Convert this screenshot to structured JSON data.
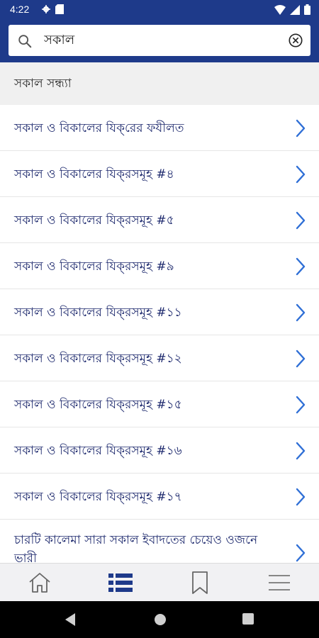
{
  "status": {
    "time": "4:22"
  },
  "search": {
    "value": "সকাল"
  },
  "section": {
    "title": "সকাল সন্ধ্যা"
  },
  "items": [
    {
      "label": "সকাল ও বিকালের যিক্‌রের ফযীলত"
    },
    {
      "label": "সকাল ও বিকালের যিক্‌রসমূহ #৪"
    },
    {
      "label": "সকাল ও বিকালের যিক্‌রসমূহ #৫"
    },
    {
      "label": "সকাল ও বিকালের যিক্‌রসমূহ #৯"
    },
    {
      "label": "সকাল ও বিকালের যিক্‌রসমূহ #১১"
    },
    {
      "label": "সকাল ও বিকালের যিক্‌রসমূহ #১২"
    },
    {
      "label": "সকাল ও বিকালের যিক্‌রসমূহ #১৫"
    },
    {
      "label": "সকাল ও বিকালের যিক্‌রসমূহ #১৬"
    },
    {
      "label": "সকাল ও বিকালের যিক্‌রসমূহ #১৭"
    },
    {
      "label": "চারটি কালেমা সারা সকাল ইবাদতের চেয়েও ওজনে ভারী"
    }
  ],
  "tabs": [
    {
      "icon": "home-icon"
    },
    {
      "icon": "list-icon",
      "active": true
    },
    {
      "icon": "bookmark-icon"
    },
    {
      "icon": "menu-icon"
    }
  ],
  "colors": {
    "primary": "#1e3a8a",
    "chevron": "#2f6fd6",
    "text": "#1e2a6e"
  }
}
